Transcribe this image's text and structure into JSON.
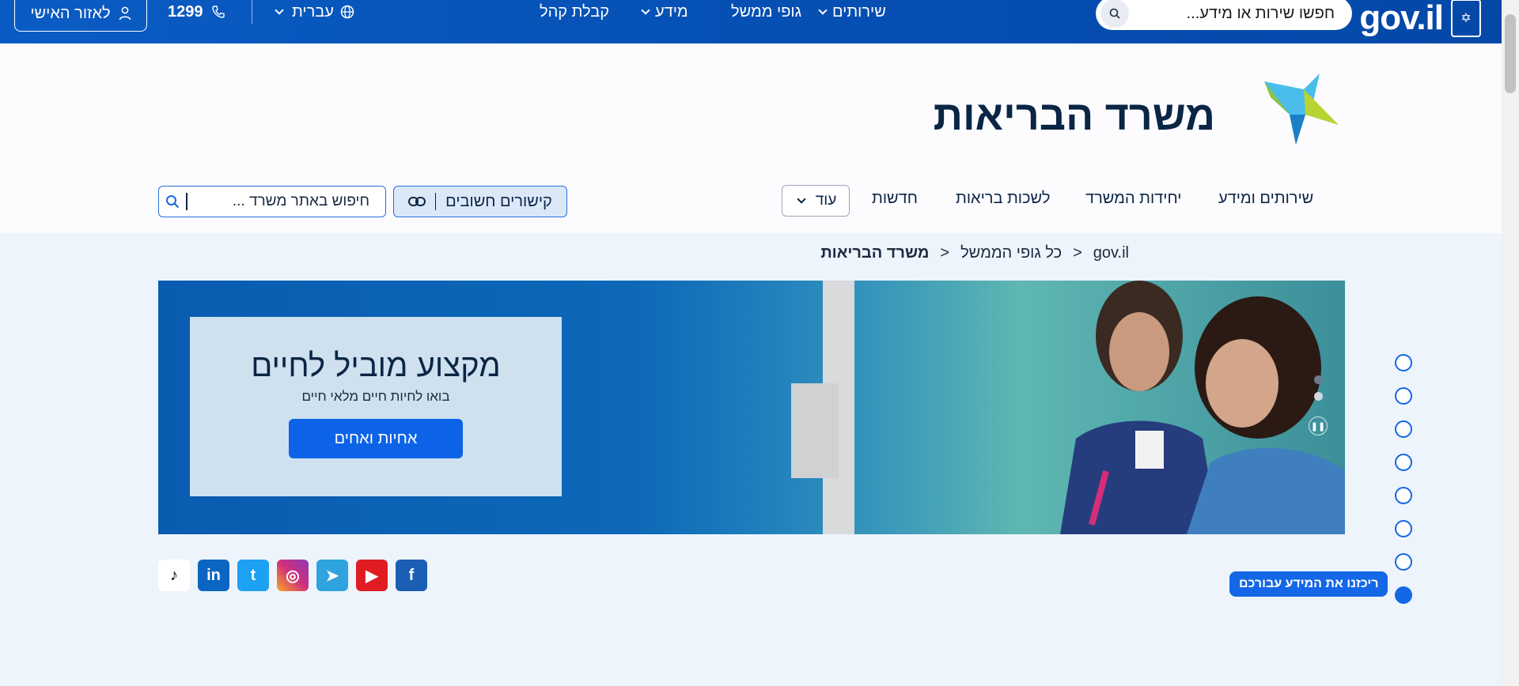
{
  "topbar": {
    "logo_text": "gov.il",
    "search_placeholder": "חפשו שירות או מידע...",
    "nav": [
      {
        "label": "שירותים",
        "has_dropdown": true
      },
      {
        "label": "גופי ממשל",
        "has_dropdown": false
      },
      {
        "label": "מידע",
        "has_dropdown": true
      },
      {
        "label": "קבלת קהל",
        "has_dropdown": false
      }
    ],
    "language": "עברית",
    "phone": "1299",
    "personal_area": "לאזור האישי",
    "bg_color": "#0650b4"
  },
  "header": {
    "ministry_name": "משרד הבריאות",
    "main_nav": [
      {
        "label": "שירותים ומידע"
      },
      {
        "label": "יחידות המשרד"
      },
      {
        "label": "לשכות בריאות"
      },
      {
        "label": "חדשות"
      }
    ],
    "more_label": "עוד",
    "links_label": "קישורים חשובים",
    "site_search_placeholder": "חיפוש באתר משרד ..."
  },
  "breadcrumb": [
    "gov.il",
    "כל גופי הממשל",
    "משרד הבריאות"
  ],
  "hero": {
    "title": "מקצוע מוביל לחיים",
    "subtitle": "בואו לחיות חיים מלאי חיים",
    "cta": "אחיות ואחים"
  },
  "social": [
    {
      "name": "facebook-icon",
      "color": "#1b5fb4",
      "glyph": "f"
    },
    {
      "name": "youtube-icon",
      "color": "#e11b22",
      "glyph": "▶"
    },
    {
      "name": "telegram-icon",
      "color": "#2ea3dd",
      "glyph": "➤"
    },
    {
      "name": "instagram-icon",
      "color": "#d1307a",
      "glyph": "◎"
    },
    {
      "name": "twitter-icon",
      "color": "#1da1f2",
      "glyph": "t"
    },
    {
      "name": "linkedin-icon",
      "color": "#0a66c2",
      "glyph": "in"
    },
    {
      "name": "tiktok-icon",
      "color": "#ffffff",
      "glyph": "♪"
    }
  ],
  "side_tooltip": "ריכזנו את המידע עבורכם",
  "colors": {
    "accent": "#1467e6",
    "dark_text": "#0b2545"
  }
}
